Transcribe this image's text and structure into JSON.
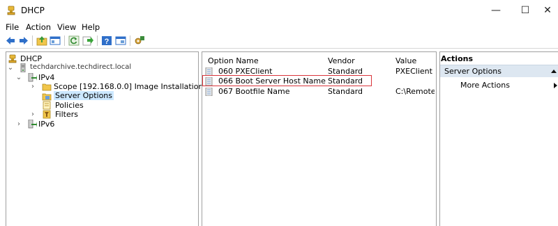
{
  "window": {
    "title": "DHCP",
    "controls": {
      "minimize": "—",
      "maximize": "☐",
      "close": "✕"
    }
  },
  "menu": {
    "items": [
      "File",
      "Action",
      "View",
      "Help"
    ]
  },
  "toolbar": {
    "buttons": [
      "back-icon",
      "forward-icon",
      "up-folder-icon",
      "show-tree-icon",
      "refresh-icon",
      "export-icon",
      "help-icon",
      "properties-icon",
      "configure-options-icon"
    ]
  },
  "tree": {
    "root": "DHCP",
    "server": "techdarchive.techdirect.local",
    "ipv4": "IPv4",
    "scope": "Scope [192.168.0.0] Image Installation",
    "server_options": "Server Options",
    "policies": "Policies",
    "filters": "Filters",
    "ipv6": "IPv6"
  },
  "list": {
    "columns": {
      "name": "Option Name",
      "vendor": "Vendor",
      "value": "Value"
    },
    "rows": [
      {
        "name": "060 PXEClient",
        "vendor": "Standard",
        "value": "PXEClient"
      },
      {
        "name": "066 Boot Server Host Name",
        "vendor": "Standard",
        "value": ""
      },
      {
        "name": "067 Bootfile Name",
        "vendor": "Standard",
        "value": "C:\\Remote"
      }
    ]
  },
  "actions": {
    "header": "Actions",
    "section": "Server Options",
    "more": "More Actions"
  },
  "colors": {
    "selection": "#cce8ff",
    "highlight_border": "#d9343a",
    "actions_band": "#dde7f1"
  }
}
